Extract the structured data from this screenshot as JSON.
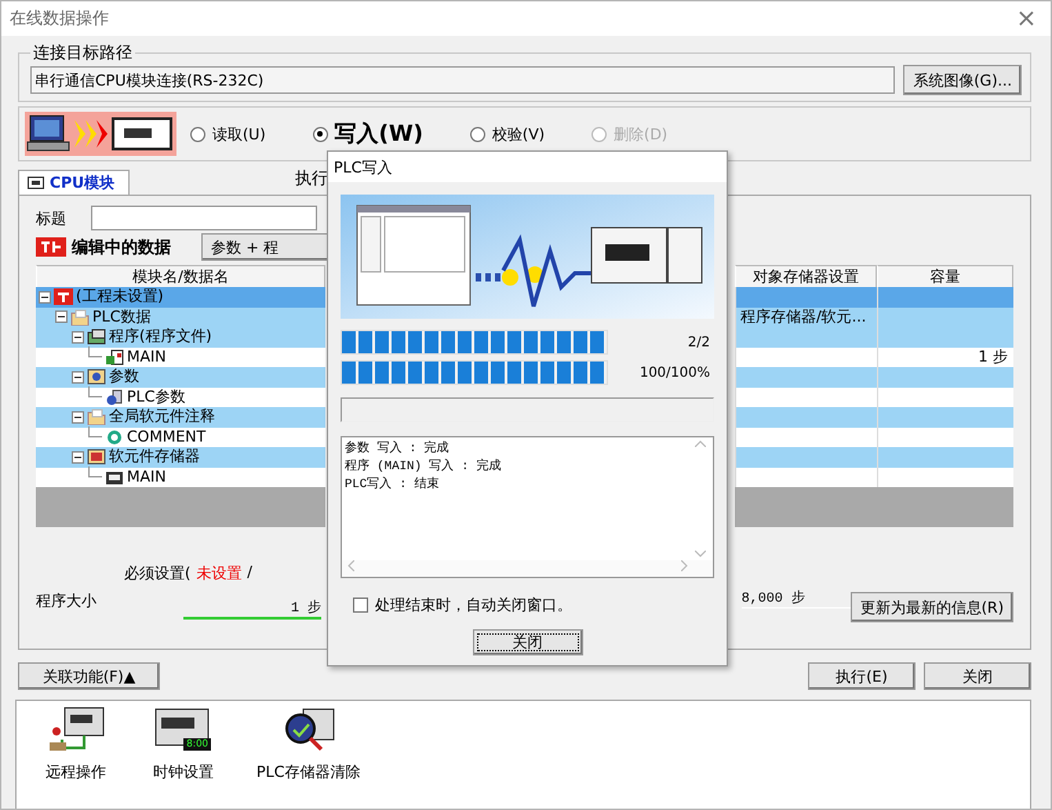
{
  "window": {
    "title": "在线数据操作",
    "close": "×"
  },
  "connection": {
    "legend": "连接目标路径",
    "value": "串行通信CPU模块连接(RS-232C)",
    "button": "系统图像(G)..."
  },
  "modes": [
    {
      "label": "读取(U)",
      "selected": false,
      "disabled": false
    },
    {
      "label": "写入(W)",
      "selected": true,
      "disabled": false
    },
    {
      "label": "校验(V)",
      "selected": false,
      "disabled": false
    },
    {
      "label": "删除(D)",
      "selected": false,
      "disabled": true
    }
  ],
  "tabs": [
    {
      "label": "CPU模块",
      "selected": true
    }
  ],
  "exec_label": "执行",
  "title_label": "标题",
  "editing": {
    "label": "编辑中的数据",
    "button": "参数 + 程"
  },
  "table": {
    "columns": [
      "模块名/数据名",
      "对象存储器设置",
      "容量"
    ],
    "tree": [
      {
        "label": "(工程未设置)",
        "kind": "project",
        "selected": true,
        "expanded": true,
        "children": [
          {
            "label": "PLC数据",
            "kind": "folder",
            "selected": false,
            "expanded": true,
            "target": "程序存储器/软元...",
            "children": [
              {
                "label": "程序(程序文件)",
                "kind": "program",
                "selected": false,
                "expanded": true,
                "children": [
                  {
                    "label": "MAIN",
                    "kind": "program-file",
                    "selected": false,
                    "capacity": "1 步"
                  }
                ]
              },
              {
                "label": "参数",
                "kind": "parameter",
                "selected": false,
                "expanded": true,
                "children": [
                  {
                    "label": "PLC参数",
                    "kind": "parameter-file",
                    "selected": false
                  }
                ]
              },
              {
                "label": "全局软元件注释",
                "kind": "folder",
                "selected": false,
                "expanded": true,
                "children": [
                  {
                    "label": "COMMENT",
                    "kind": "comment",
                    "selected": false
                  }
                ]
              },
              {
                "label": "软元件存储器",
                "kind": "device",
                "selected": false,
                "expanded": true,
                "children": [
                  {
                    "label": "MAIN",
                    "kind": "device-file",
                    "selected": false
                  }
                ]
              }
            ]
          }
        ]
      }
    ]
  },
  "required": {
    "label": "必须设置(",
    "value": "未设置",
    "separator": "/"
  },
  "size": {
    "label": "程序大小",
    "used": "1 步",
    "total": "8,000 步"
  },
  "update_button": "更新为最新的信息(R)",
  "related_button": "关联功能(F)▲",
  "buttons": [
    "执行(E)",
    "关闭"
  ],
  "tools": [
    {
      "label": "远程操作",
      "kind": "remote"
    },
    {
      "label": "时钟设置",
      "kind": "clock",
      "display": "8:00"
    },
    {
      "label": "PLC存储器清除",
      "kind": "clear"
    }
  ],
  "dialog": {
    "title": "PLC写入",
    "progress": [
      {
        "level": 1,
        "reading": "2/2"
      },
      {
        "level": 1,
        "reading": "100/100%"
      }
    ],
    "log": [
      "参数 写入 : 完成",
      "程序 (MAIN) 写入 : 完成",
      "PLC写入 : 结束"
    ],
    "auto_close": {
      "label": "处理结束时，自动关闭窗口。",
      "checked": false
    },
    "button": "关闭"
  }
}
